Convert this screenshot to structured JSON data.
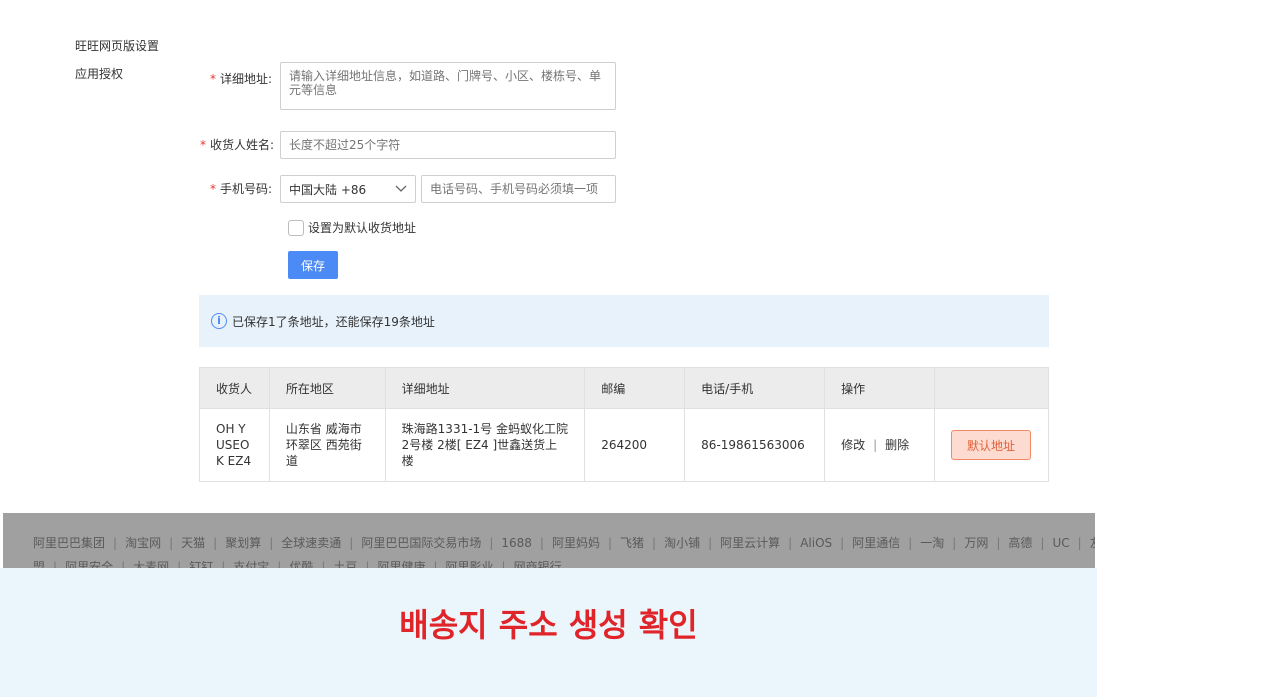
{
  "left_menu": {
    "items": [
      "旺旺网页版设置",
      "应用授权"
    ]
  },
  "form": {
    "address": {
      "label": "详细地址:",
      "placeholder": "请输入详细地址信息，如道路、门牌号、小区、楼栋号、单元等信息"
    },
    "name": {
      "label": "收货人姓名:",
      "placeholder": "长度不超过25个字符"
    },
    "phone": {
      "label": "手机号码:",
      "country": "中国大陆 +86",
      "placeholder": "电话号码、手机号码必须填一项"
    },
    "required_mark": "*",
    "default_checkbox_label": "设置为默认收货地址",
    "save_label": "保存"
  },
  "info": {
    "icon": "info-icon",
    "text": "已保存1了条地址，还能保存19条地址"
  },
  "table": {
    "headers": [
      "收货人",
      "所在地区",
      "详细地址",
      "邮编",
      "电话/手机",
      "操作",
      ""
    ],
    "rows": [
      {
        "recipient": "OH Y USEO K EZ4",
        "region": "山东省 威海市 环翠区 西苑街道",
        "address": "珠海路1331-1号 金蚂蚁化工院2号楼 2楼[ EZ4 ]世鑫送货上楼",
        "zip": "264200",
        "phone": "86-19861563006",
        "edit": "修改",
        "sep": "|",
        "delete": "删除",
        "default_label": "默认地址"
      }
    ]
  },
  "footer": {
    "links": [
      "阿里巴巴集团",
      "淘宝网",
      "天猫",
      "聚划算",
      "全球速卖通",
      "阿里巴巴国际交易市场",
      "1688",
      "阿里妈妈",
      "飞猪",
      "淘小铺",
      "阿里云计算",
      "AliOS",
      "阿里通信",
      "一淘",
      "万网",
      "高德",
      "UC",
      "友盟",
      "阿里安全",
      "大麦网",
      "钉钉",
      "支付宝",
      "优酷",
      "土豆",
      "阿里健康",
      "阿里影业",
      "网商银行"
    ],
    "separator": "|"
  },
  "caption": {
    "text": "배송지 주소 생성 확인"
  }
}
